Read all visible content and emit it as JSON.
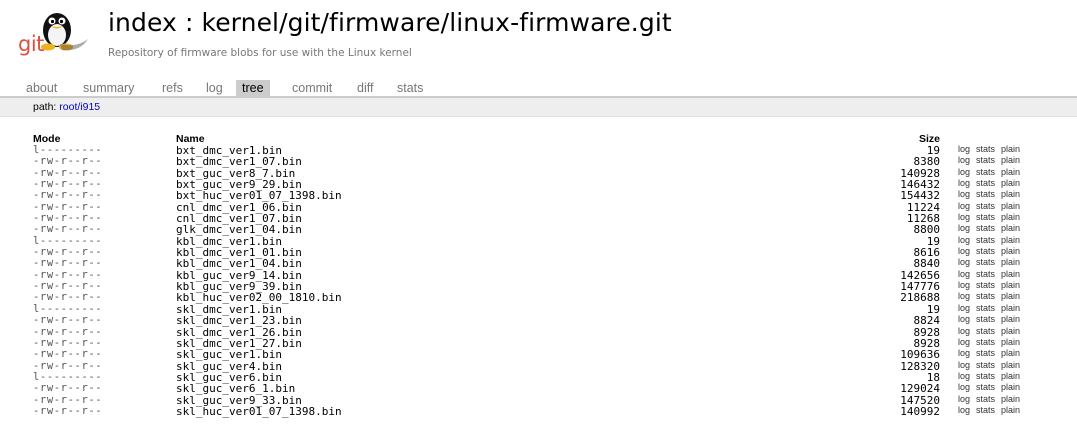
{
  "header": {
    "title": "index : kernel/git/firmware/linux-firmware.git",
    "subtitle": "Repository of firmware blobs for use with the Linux kernel",
    "logo_text": "git"
  },
  "tabs": [
    {
      "label": "about"
    },
    {
      "label": "summary"
    },
    {
      "label": "refs"
    },
    {
      "label": "log"
    },
    {
      "label": "tree"
    },
    {
      "label": "commit"
    },
    {
      "label": "diff"
    },
    {
      "label": "stats"
    }
  ],
  "active_tab": "tree",
  "path": {
    "label": "path:",
    "root": "root",
    "sep": "/",
    "dir": "i915"
  },
  "table": {
    "headers": {
      "mode": "Mode",
      "name": "Name",
      "size": "Size"
    },
    "action_labels": [
      "log",
      "stats",
      "plain"
    ],
    "rows": [
      {
        "mode": "l---------",
        "name": "bxt_dmc_ver1.bin",
        "size": "19"
      },
      {
        "mode": "-rw-r--r--",
        "name": "bxt_dmc_ver1_07.bin",
        "size": "8380"
      },
      {
        "mode": "-rw-r--r--",
        "name": "bxt_guc_ver8_7.bin",
        "size": "140928"
      },
      {
        "mode": "-rw-r--r--",
        "name": "bxt_guc_ver9_29.bin",
        "size": "146432"
      },
      {
        "mode": "-rw-r--r--",
        "name": "bxt_huc_ver01_07_1398.bin",
        "size": "154432"
      },
      {
        "mode": "-rw-r--r--",
        "name": "cnl_dmc_ver1_06.bin",
        "size": "11224"
      },
      {
        "mode": "-rw-r--r--",
        "name": "cnl_dmc_ver1_07.bin",
        "size": "11268"
      },
      {
        "mode": "-rw-r--r--",
        "name": "glk_dmc_ver1_04.bin",
        "size": "8800"
      },
      {
        "mode": "l---------",
        "name": "kbl_dmc_ver1.bin",
        "size": "19"
      },
      {
        "mode": "-rw-r--r--",
        "name": "kbl_dmc_ver1_01.bin",
        "size": "8616"
      },
      {
        "mode": "-rw-r--r--",
        "name": "kbl_dmc_ver1_04.bin",
        "size": "8840"
      },
      {
        "mode": "-rw-r--r--",
        "name": "kbl_guc_ver9_14.bin",
        "size": "142656"
      },
      {
        "mode": "-rw-r--r--",
        "name": "kbl_guc_ver9_39.bin",
        "size": "147776"
      },
      {
        "mode": "-rw-r--r--",
        "name": "kbl_huc_ver02_00_1810.bin",
        "size": "218688"
      },
      {
        "mode": "l---------",
        "name": "skl_dmc_ver1.bin",
        "size": "19"
      },
      {
        "mode": "-rw-r--r--",
        "name": "skl_dmc_ver1_23.bin",
        "size": "8824"
      },
      {
        "mode": "-rw-r--r--",
        "name": "skl_dmc_ver1_26.bin",
        "size": "8928"
      },
      {
        "mode": "-rw-r--r--",
        "name": "skl_dmc_ver1_27.bin",
        "size": "8928"
      },
      {
        "mode": "-rw-r--r--",
        "name": "skl_guc_ver1.bin",
        "size": "109636"
      },
      {
        "mode": "-rw-r--r--",
        "name": "skl_guc_ver4.bin",
        "size": "128320"
      },
      {
        "mode": "l---------",
        "name": "skl_guc_ver6.bin",
        "size": "18"
      },
      {
        "mode": "-rw-r--r--",
        "name": "skl_guc_ver6_1.bin",
        "size": "129024"
      },
      {
        "mode": "-rw-r--r--",
        "name": "skl_guc_ver9_33.bin",
        "size": "147520"
      },
      {
        "mode": "-rw-r--r--",
        "name": "skl_huc_ver01_07_1398.bin",
        "size": "140992"
      }
    ]
  },
  "colors": {
    "link": "#0000cc",
    "tab_active_bg": "#cccccc",
    "path_bar_bg": "#eeeeee",
    "logo_red": "#e05040"
  }
}
